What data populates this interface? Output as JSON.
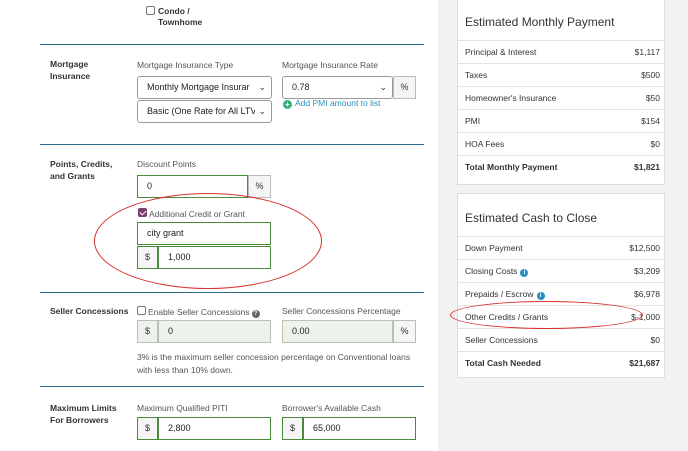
{
  "property_type": {
    "option_label": "Condo / Townhome"
  },
  "mortgage_insurance": {
    "section_label": "Mortgage Insurance",
    "type_label": "Mortgage Insurance Type",
    "type_value": "Monthly Mortgage Insurar",
    "basic_value": "Basic (One Rate for All LTV",
    "rate_label": "Mortgage Insurance Rate",
    "rate_value": "0.78",
    "rate_unit": "%",
    "add_pmi_link": "Add PMI amount to list"
  },
  "points": {
    "section_label": "Points, Credits, and Grants",
    "discount_label": "Discount Points",
    "discount_value": "0",
    "discount_unit": "%",
    "credit_checkbox_label": "Additional Credit or Grant",
    "credit_checked": true,
    "credit_name": "city grant",
    "credit_currency": "$",
    "credit_amount": "1,000"
  },
  "seller": {
    "section_label": "Seller Concessions",
    "enable_label": "Enable Seller Concessions",
    "enabled": false,
    "currency": "$",
    "amount": "0",
    "pct_label": "Seller Concessions Percentage",
    "pct_value": "0.00",
    "pct_unit": "%",
    "note": "3% is the maximum seller concession percentage on Conventional loans with less than 10% down."
  },
  "limits": {
    "section_label": "Maximum Limits For Borrowers",
    "piti_label": "Maximum Qualified PITI",
    "piti_currency": "$",
    "piti_value": "2,800",
    "cash_label": "Borrower's Available Cash",
    "cash_currency": "$",
    "cash_value": "65,000"
  },
  "monthly_payment": {
    "title": "Estimated Monthly Payment",
    "rows": [
      {
        "label": "Principal & Interest",
        "value": "$1,117"
      },
      {
        "label": "Taxes",
        "value": "$500"
      },
      {
        "label": "Homeowner's Insurance",
        "value": "$50"
      },
      {
        "label": "PMI",
        "value": "$154"
      },
      {
        "label": "HOA Fees",
        "value": "$0"
      }
    ],
    "total_label": "Total Monthly Payment",
    "total_value": "$1,821"
  },
  "cash_to_close": {
    "title": "Estimated Cash to Close",
    "rows": [
      {
        "label": "Down Payment",
        "value": "$12,500"
      },
      {
        "label": "Closing Costs",
        "value": "$3,209"
      },
      {
        "label": "Prepaids / Escrow",
        "value": "$6,978"
      },
      {
        "label": "Other Credits / Grants",
        "value": "$-1,000"
      },
      {
        "label": "Seller Concessions",
        "value": "$0"
      }
    ],
    "total_label": "Total Cash Needed",
    "total_value": "$21,687"
  },
  "colors": {
    "accent_divider": "#2d6f8e",
    "valid_border": "#4a8a3c",
    "annotation_red": "#d6312b",
    "link_blue": "#2a8fbd",
    "checkbox_purple": "#7a3e6a"
  }
}
